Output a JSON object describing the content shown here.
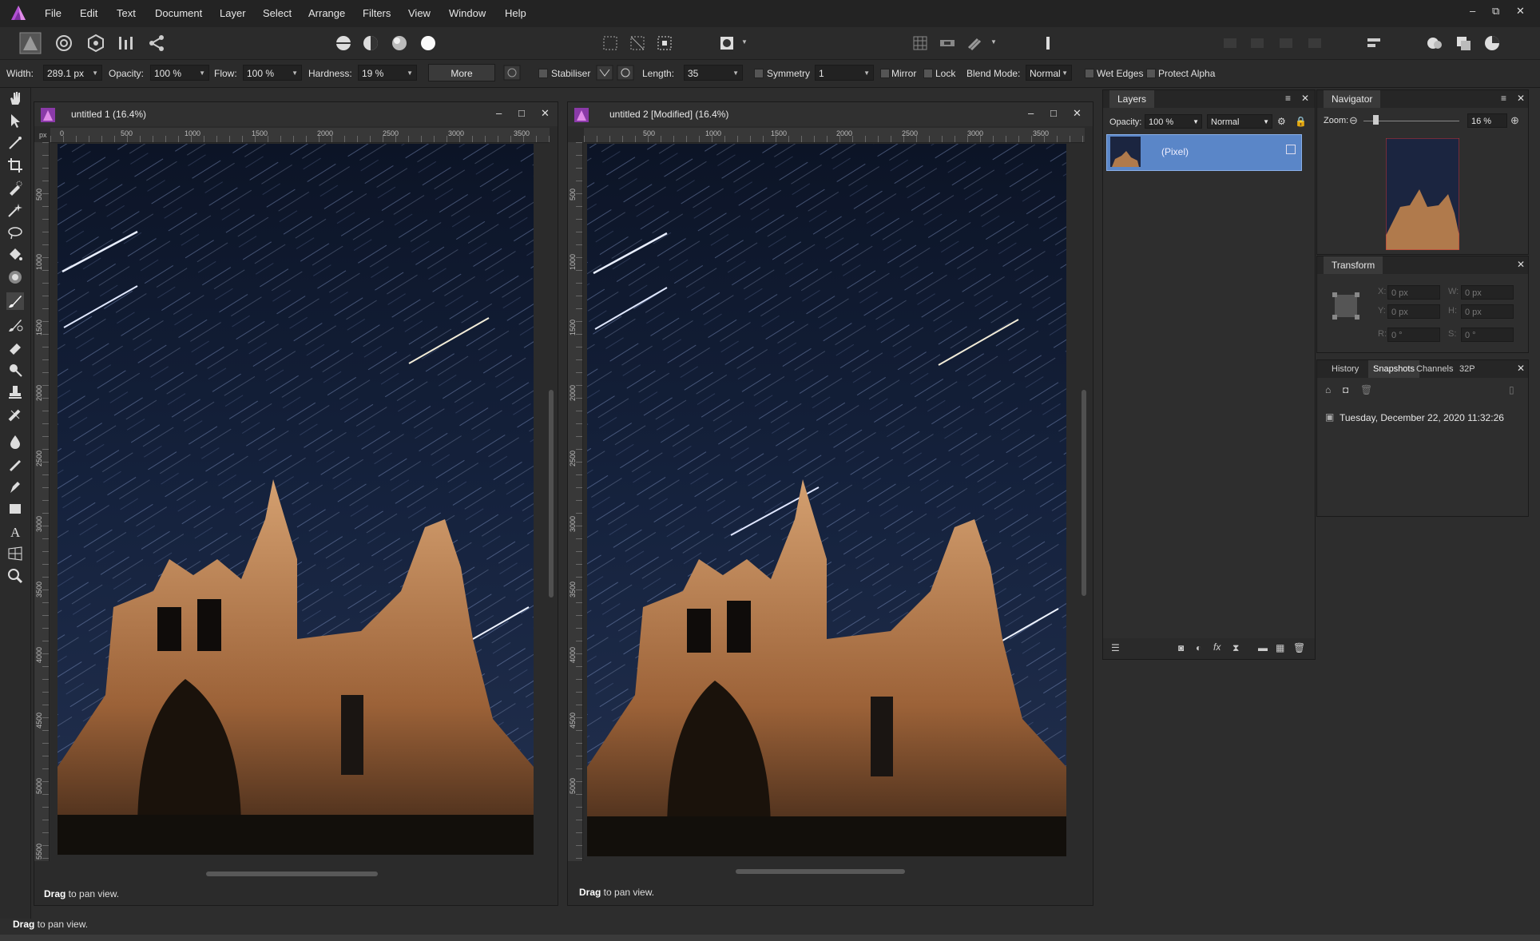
{
  "app": {
    "accent": "#b04fd2"
  },
  "menu": [
    "File",
    "Edit",
    "Text",
    "Document",
    "Layer",
    "Select",
    "Arrange",
    "Filters",
    "View",
    "Window",
    "Help"
  ],
  "window_controls": {
    "minimize": "–",
    "restore": "⧉",
    "close": "✕"
  },
  "context": {
    "width_label": "Width:",
    "width_value": "289.1 px",
    "opacity_label": "Opacity:",
    "opacity_value": "100 %",
    "flow_label": "Flow:",
    "flow_value": "100 %",
    "hardness_label": "Hardness:",
    "hardness_value": "19 %",
    "more_label": "More",
    "stabiliser_label": "Stabiliser",
    "length_label": "Length:",
    "length_value": "35",
    "symmetry_label": "Symmetry",
    "symmetry_value": "1",
    "mirror_label": "Mirror",
    "lock_label": "Lock",
    "blend_label": "Blend Mode:",
    "blend_value": "Normal",
    "wet_edges_label": "Wet Edges",
    "protect_alpha_label": "Protect Alpha"
  },
  "doc1": {
    "title": "untitled 1 (16.4%)",
    "hint_bold": "Drag",
    "hint_rest": " to pan view.",
    "ruler_h": [
      "0",
      "500",
      "1000",
      "1500",
      "2000",
      "2500",
      "3000",
      "3500"
    ],
    "ruler_v": [
      "500",
      "1000",
      "1500",
      "2000",
      "2500",
      "3000",
      "3500",
      "4000",
      "4500",
      "5000",
      "5500"
    ],
    "ruler_unit": "px"
  },
  "doc2": {
    "title": "untitled 2 [Modified] (16.4%)",
    "hint_bold": "Drag",
    "hint_rest": " to pan view.",
    "ruler_h": [
      "500",
      "1000",
      "1500",
      "2000",
      "2500",
      "3000",
      "3500"
    ],
    "ruler_v": [
      "500",
      "1000",
      "1500",
      "2000",
      "2500",
      "3000",
      "3500",
      "4000",
      "4500",
      "5000"
    ]
  },
  "layers": {
    "tab": "Layers",
    "opacity_label": "Opacity:",
    "opacity_value": "100 %",
    "blend_value": "Normal",
    "layer_name": "(Pixel)"
  },
  "navigator": {
    "tab": "Navigator",
    "zoom_label": "Zoom:",
    "zoom_value": "16 %"
  },
  "transform": {
    "tab": "Transform",
    "x_label": "X:",
    "x_value": "0 px",
    "y_label": "Y:",
    "y_value": "0 px",
    "w_label": "W:",
    "w_value": "0 px",
    "h_label": "H:",
    "h_value": "0 px",
    "r_label": "R:",
    "r_value": "0 °",
    "s_label": "S:",
    "s_value": "0 °"
  },
  "history": {
    "tabs": [
      "History",
      "Snapshots",
      "Channels",
      "32P"
    ],
    "active_tab": "Snapshots",
    "snapshot": "Tuesday, December 22, 2020 11:32:26"
  },
  "status": {
    "hint_bold": "Drag",
    "hint_rest": " to pan view."
  }
}
